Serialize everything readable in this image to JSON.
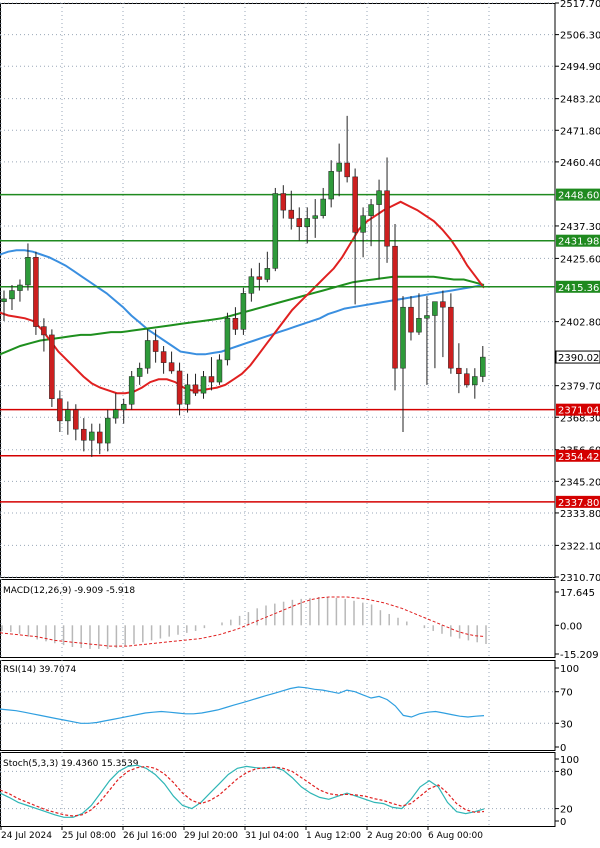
{
  "colors": {
    "bull": "#2e9a3a",
    "bear": "#cc1f1f",
    "ema_fast": "#e02020",
    "ema_mid": "#3a8fe0",
    "ema_slow": "#1e8f1e",
    "level_green": "#1f8a1f",
    "level_red": "#d40000",
    "grid": "#9aa7b8",
    "axis": "#000000",
    "macd_hist": "#b8b8b8",
    "macd_signal": "#e02020",
    "rsi": "#2f9fe0",
    "stoch_main": "#2fb6b6",
    "stoch_signal": "#e02020"
  },
  "price_axis_labels": [
    "2517.70",
    "2506.30",
    "2494.90",
    "2483.20",
    "2471.80",
    "2460.40",
    "2437.30",
    "2425.60",
    "2402.80",
    "2379.70",
    "2368.30",
    "2356.60",
    "2345.20",
    "2333.80",
    "2322.10",
    "2310.70"
  ],
  "time_labels": [
    "24 Jul 2024",
    "25 Jul 08:00",
    "26 Jul 16:00",
    "29 Jul 20:00",
    "31 Jul 04:00",
    "1 Aug 12:00",
    "2 Aug 20:00",
    "6 Aug 00:00"
  ],
  "chart_data": [
    {
      "type": "candlestick",
      "ylim": [
        2310.7,
        2517.7
      ],
      "candles": [
        [
          2410.0,
          2414.0,
          2403.0,
          2411.0
        ],
        [
          2411.0,
          2416.0,
          2407.0,
          2414.0
        ],
        [
          2414.0,
          2418.0,
          2410.0,
          2416.0
        ],
        [
          2416.0,
          2431.0,
          2414.0,
          2426.0
        ],
        [
          2426.0,
          2428.0,
          2398.0,
          2401.0
        ],
        [
          2401.0,
          2404.0,
          2392.0,
          2398.0
        ],
        [
          2398.0,
          2400.0,
          2372.0,
          2375.0
        ],
        [
          2375.0,
          2378.0,
          2363.0,
          2367.0
        ],
        [
          2367.0,
          2374.0,
          2362.0,
          2371.0
        ],
        [
          2371.0,
          2373.0,
          2360.0,
          2364.0
        ],
        [
          2364.0,
          2368.0,
          2356.0,
          2360.0
        ],
        [
          2360.0,
          2366.0,
          2354.0,
          2363.0
        ],
        [
          2363.0,
          2366.0,
          2355.0,
          2359.0
        ],
        [
          2359.0,
          2371.0,
          2356.0,
          2368.0
        ],
        [
          2368.0,
          2377.0,
          2366.0,
          2371.0
        ],
        [
          2371.0,
          2375.0,
          2366.0,
          2373.0
        ],
        [
          2373.0,
          2385.0,
          2371.0,
          2383.0
        ],
        [
          2383.0,
          2388.0,
          2380.0,
          2386.0
        ],
        [
          2386.0,
          2400.0,
          2384.0,
          2396.0
        ],
        [
          2396.0,
          2400.0,
          2388.0,
          2392.0
        ],
        [
          2392.0,
          2394.0,
          2384.0,
          2388.0
        ],
        [
          2388.0,
          2392.0,
          2384.0,
          2385.0
        ],
        [
          2385.0,
          2388.0,
          2369.0,
          2373.0
        ],
        [
          2373.0,
          2384.0,
          2370.0,
          2380.0
        ],
        [
          2380.0,
          2384.0,
          2376.0,
          2377.0
        ],
        [
          2377.0,
          2385.0,
          2375.0,
          2383.0
        ],
        [
          2383.0,
          2390.0,
          2378.0,
          2381.0
        ],
        [
          2381.0,
          2391.0,
          2380.0,
          2389.0
        ],
        [
          2389.0,
          2406.0,
          2387.0,
          2404.0
        ],
        [
          2404.0,
          2408.0,
          2398.0,
          2400.0
        ],
        [
          2400.0,
          2415.0,
          2398.0,
          2413.0
        ],
        [
          2413.0,
          2422.0,
          2410.0,
          2419.0
        ],
        [
          2419.0,
          2424.0,
          2414.0,
          2418.0
        ],
        [
          2418.0,
          2428.0,
          2417.0,
          2422.0
        ],
        [
          2422.0,
          2451.0,
          2421.0,
          2449.0
        ],
        [
          2449.0,
          2452.0,
          2440.0,
          2443.0
        ],
        [
          2443.0,
          2450.0,
          2436.0,
          2440.0
        ],
        [
          2440.0,
          2444.0,
          2432.0,
          2437.0
        ],
        [
          2437.0,
          2444.0,
          2431.0,
          2440.0
        ],
        [
          2440.0,
          2447.0,
          2433.0,
          2441.0
        ],
        [
          2441.0,
          2451.0,
          2440.0,
          2447.0
        ],
        [
          2447.0,
          2461.0,
          2444.0,
          2457.0
        ],
        [
          2457.0,
          2467.0,
          2448.0,
          2460.0
        ],
        [
          2460.0,
          2477.0,
          2453.0,
          2455.0
        ],
        [
          2455.0,
          2458.0,
          2409.0,
          2435.0
        ],
        [
          2435.0,
          2444.0,
          2426.0,
          2441.0
        ],
        [
          2441.0,
          2447.0,
          2430.0,
          2445.0
        ],
        [
          2445.0,
          2454.0,
          2418.0,
          2450.0
        ],
        [
          2450.0,
          2462.0,
          2424.0,
          2430.0
        ],
        [
          2430.0,
          2438.0,
          2378.0,
          2386.0
        ],
        [
          2386.0,
          2412.0,
          2363.0,
          2408.0
        ],
        [
          2408.0,
          2412.0,
          2396.0,
          2399.0
        ],
        [
          2399.0,
          2413.0,
          2398.0,
          2404.0
        ],
        [
          2404.0,
          2412.0,
          2380.0,
          2405.0
        ],
        [
          2405.0,
          2407.0,
          2386.0,
          2410.0
        ],
        [
          2410.0,
          2414.0,
          2390.0,
          2408.0
        ],
        [
          2408.0,
          2413.0,
          2384.0,
          2386.0
        ],
        [
          2386.0,
          2395.0,
          2377.0,
          2384.0
        ],
        [
          2384.0,
          2386.0,
          2379.0,
          2380.0
        ],
        [
          2380.0,
          2386.0,
          2375.0,
          2383.0
        ],
        [
          2383.0,
          2394.0,
          2381.0,
          2390.0
        ]
      ],
      "ema_fast": [
        2406.0,
        2405.0,
        2404.5,
        2404.0,
        2403.0,
        2400.0,
        2396.0,
        2392.0,
        2389.0,
        2386.0,
        2383.0,
        2380.5,
        2379.0,
        2378.0,
        2377.0,
        2377.0,
        2377.5,
        2379.0,
        2381.0,
        2382.0,
        2382.0,
        2381.0,
        2379.0,
        2378.0,
        2378.0,
        2378.5,
        2379.0,
        2380.0,
        2382.0,
        2384.0,
        2387.0,
        2391.0,
        2395.0,
        2399.0,
        2403.0,
        2407.0,
        2410.0,
        2413.0,
        2416.0,
        2419.0,
        2422.0,
        2426.0,
        2431.0,
        2436.0,
        2439.0,
        2441.0,
        2443.0,
        2444.5,
        2446.0,
        2444.5,
        2443.0,
        2441.0,
        2439.0,
        2436.0,
        2432.5,
        2428.0,
        2423.0,
        2419.0,
        2415.0
      ],
      "ema_mid": [
        2427.0,
        2428.0,
        2428.5,
        2428.5,
        2428.0,
        2427.0,
        2426.0,
        2424.5,
        2423.0,
        2421.0,
        2419.0,
        2417.0,
        2415.0,
        2413.0,
        2410.5,
        2408.0,
        2405.0,
        2402.5,
        2400.0,
        2398.0,
        2396.0,
        2394.0,
        2392.0,
        2391.5,
        2391.0,
        2391.0,
        2391.5,
        2392.0,
        2393.0,
        2394.0,
        2395.0,
        2396.0,
        2397.0,
        2398.0,
        2399.0,
        2400.0,
        2401.0,
        2402.0,
        2403.0,
        2404.0,
        2405.5,
        2406.5,
        2407.5,
        2408.0,
        2408.5,
        2409.0,
        2409.5,
        2410.0,
        2410.5,
        2411.0,
        2411.5,
        2412.0,
        2412.5,
        2413.0,
        2413.5,
        2414.0,
        2414.5,
        2415.0,
        2415.5,
        2416.0
      ],
      "ema_slow": [
        2391.0,
        2392.5,
        2394.0,
        2395.0,
        2396.0,
        2396.5,
        2397.0,
        2397.5,
        2398.0,
        2398.0,
        2398.5,
        2399.0,
        2399.0,
        2399.5,
        2400.0,
        2400.5,
        2401.0,
        2401.5,
        2402.0,
        2402.5,
        2403.0,
        2403.5,
        2404.0,
        2405.0,
        2406.0,
        2407.0,
        2408.0,
        2409.0,
        2410.0,
        2411.0,
        2412.0,
        2413.0,
        2414.0,
        2415.0,
        2416.0,
        2417.0,
        2417.5,
        2418.0,
        2418.5,
        2419.0,
        2419.0,
        2419.0,
        2419.0,
        2419.0,
        2418.5,
        2418.0,
        2418.0,
        2417.0,
        2416.0
      ],
      "levels": [
        {
          "label": "2448.60",
          "value": 2448.6,
          "kind": "green"
        },
        {
          "label": "2431.98",
          "value": 2431.98,
          "kind": "green"
        },
        {
          "label": "2415.36",
          "value": 2415.36,
          "kind": "green"
        },
        {
          "label": "2371.04",
          "value": 2371.04,
          "kind": "red"
        },
        {
          "label": "2354.42",
          "value": 2354.42,
          "kind": "red"
        },
        {
          "label": "2337.80",
          "value": 2337.8,
          "kind": "red"
        }
      ],
      "current_price": {
        "label": "2390.02",
        "value": 2390.02
      }
    },
    {
      "type": "bar",
      "title": "MACD(12,26,9) -9.909 -5.918",
      "ylim": [
        -15.209,
        17.645
      ],
      "tick_labels": [
        "17.645",
        "0.00",
        "-15.209"
      ],
      "tick_values": [
        17.645,
        0.0,
        -15.209
      ],
      "histogram": [
        -3.0,
        -3.5,
        -4.5,
        -6.0,
        -7.5,
        -8.5,
        -9.5,
        -10.5,
        -11.5,
        -12.0,
        -12.5,
        -12.5,
        -12.5,
        -12.0,
        -11.0,
        -10.0,
        -9.0,
        -8.0,
        -7.0,
        -6.0,
        -5.0,
        -4.0,
        -3.0,
        -1.5,
        0.0,
        1.5,
        3.0,
        5.0,
        7.0,
        9.0,
        10.5,
        11.5,
        12.5,
        13.5,
        14.0,
        14.5,
        15.0,
        15.0,
        14.5,
        14.0,
        13.0,
        12.0,
        11.0,
        8.0,
        6.0,
        4.0,
        2.0,
        0.0,
        -1.5,
        -3.0,
        -4.5,
        -6.0,
        -7.0,
        -8.0,
        -9.0,
        -9.909
      ],
      "signal": [
        -4.0,
        -4.5,
        -5.0,
        -5.5,
        -6.0,
        -7.0,
        -8.0,
        -8.5,
        -9.0,
        -9.5,
        -10.0,
        -10.5,
        -11.0,
        -11.0,
        -11.0,
        -10.5,
        -10.0,
        -9.5,
        -9.0,
        -8.5,
        -8.0,
        -7.5,
        -7.0,
        -6.0,
        -5.0,
        -3.5,
        -2.0,
        0.0,
        2.0,
        4.0,
        6.0,
        8.0,
        10.0,
        12.0,
        13.5,
        14.5,
        15.0,
        15.0,
        15.0,
        14.5,
        14.0,
        13.0,
        12.0,
        10.5,
        9.0,
        7.0,
        5.0,
        3.0,
        1.0,
        -1.0,
        -3.0,
        -4.5,
        -5.5,
        -5.918
      ]
    },
    {
      "type": "line",
      "title": "RSI(14) 39.7074",
      "ylim": [
        0,
        100
      ],
      "tick_labels": [
        "100",
        "70",
        "30",
        "0"
      ],
      "tick_values": [
        100,
        70,
        30,
        0
      ],
      "values": [
        48,
        47,
        46,
        44,
        42,
        40,
        38,
        36,
        34,
        32,
        30,
        30,
        31,
        33,
        35,
        37,
        39,
        41,
        43,
        44,
        45,
        44,
        43,
        42,
        42,
        43,
        45,
        47,
        50,
        53,
        56,
        59,
        62,
        65,
        68,
        71,
        74,
        76,
        75,
        73,
        72,
        70,
        68,
        72,
        70,
        66,
        62,
        64,
        60,
        52,
        40,
        38,
        42,
        44,
        45,
        43,
        41,
        39,
        38,
        39,
        39.7
      ]
    },
    {
      "type": "line",
      "title": "Stoch(5,3,3) 19.4360 15.3539",
      "ylim": [
        0,
        100
      ],
      "tick_labels": [
        "100",
        "80",
        "20",
        "0"
      ],
      "tick_values": [
        100,
        80,
        20,
        0
      ],
      "main": [
        45,
        38,
        30,
        25,
        20,
        15,
        10,
        6,
        6,
        12,
        25,
        45,
        65,
        80,
        88,
        90,
        85,
        75,
        60,
        40,
        25,
        20,
        30,
        45,
        60,
        75,
        85,
        88,
        86,
        85,
        87,
        82,
        70,
        55,
        45,
        38,
        35,
        40,
        45,
        40,
        35,
        30,
        28,
        22,
        20,
        35,
        55,
        65,
        55,
        30,
        15,
        12,
        15,
        19.436
      ],
      "signal": [
        50,
        44,
        36,
        30,
        24,
        18,
        14,
        10,
        8,
        10,
        18,
        32,
        50,
        68,
        80,
        86,
        88,
        85,
        76,
        62,
        45,
        33,
        28,
        33,
        42,
        55,
        68,
        78,
        84,
        86,
        87,
        85,
        80,
        70,
        60,
        50,
        44,
        42,
        43,
        42,
        40,
        36,
        33,
        28,
        24,
        28,
        40,
        52,
        58,
        45,
        28,
        18,
        14,
        15.354
      ]
    }
  ]
}
